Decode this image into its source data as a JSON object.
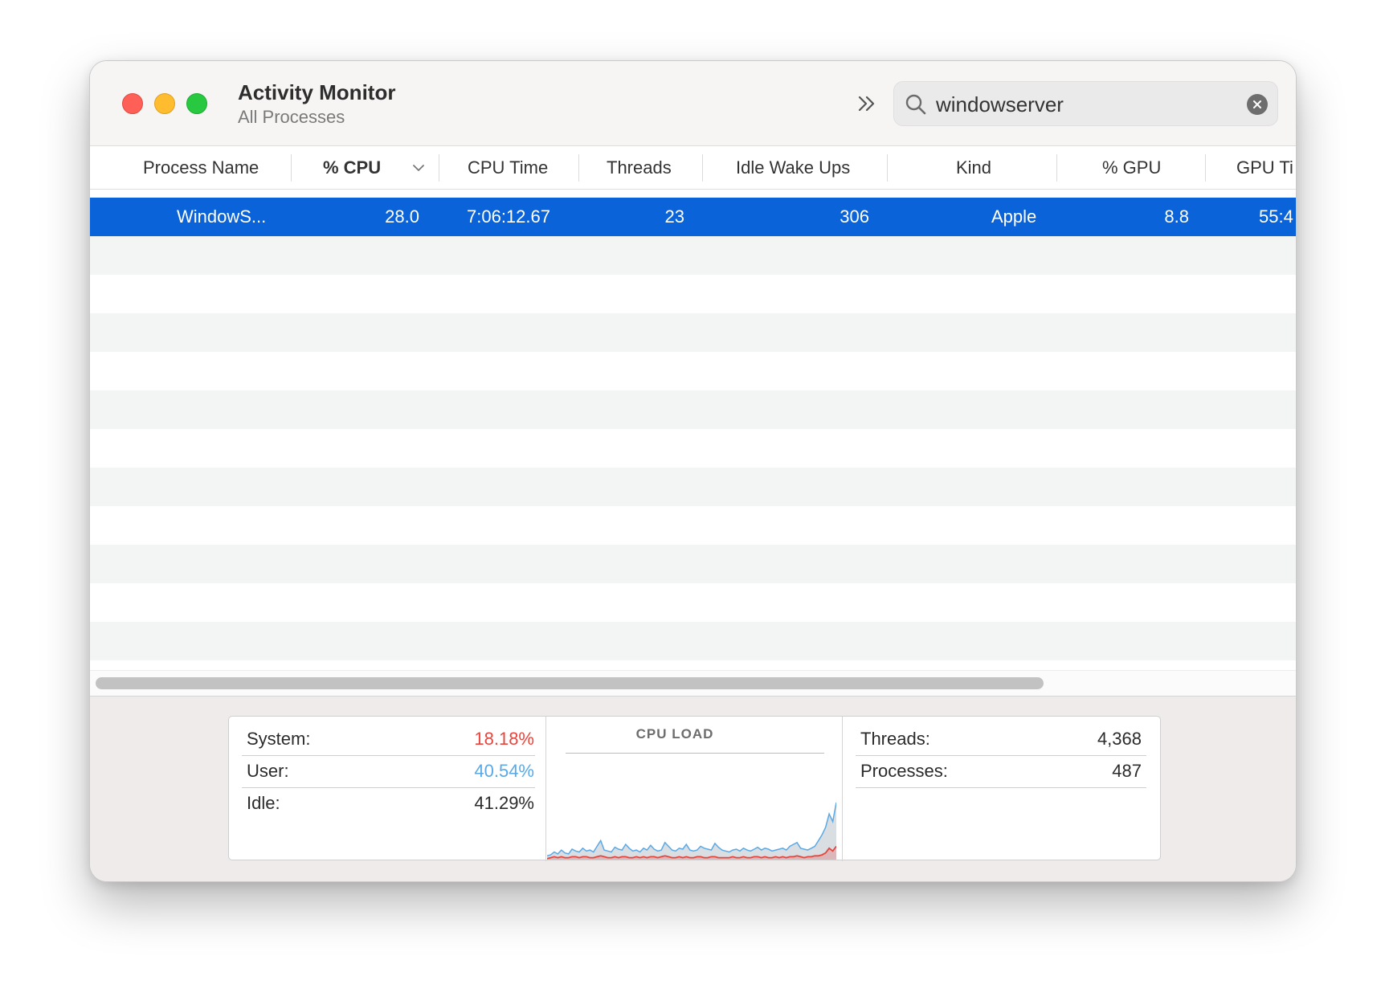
{
  "app": {
    "title": "Activity Monitor",
    "subtitle": "All Processes"
  },
  "toolbar": {
    "overflow_icon": "chevrons-right-icon"
  },
  "search": {
    "value": "windowserver",
    "icon": "search-icon",
    "clear_icon": "clear-icon"
  },
  "columns": [
    "Process Name",
    "% CPU",
    "CPU Time",
    "Threads",
    "Idle Wake Ups",
    "Kind",
    "% GPU",
    "GPU Ti"
  ],
  "sort": {
    "column": "% CPU",
    "direction": "descending"
  },
  "processes": [
    {
      "name": "WindowS...",
      "cpu": "28.0",
      "cpu_time": "7:06:12.67",
      "threads": "23",
      "idle_wake_ups": "306",
      "kind": "Apple",
      "gpu": "8.8",
      "gpu_time": "55:4",
      "selected": true
    }
  ],
  "cpu_stats": {
    "system_label": "System:",
    "system_value": "18.18%",
    "user_label": "User:",
    "user_value": "40.54%",
    "idle_label": "Idle:",
    "idle_value": "41.29%"
  },
  "cpu_load": {
    "title": "CPU LOAD",
    "colors": {
      "system": "#e8453c",
      "user": "#5aa9e6",
      "fill": "#d9dee3"
    },
    "user_series": [
      4,
      5,
      8,
      6,
      10,
      7,
      6,
      11,
      9,
      8,
      12,
      9,
      10,
      8,
      14,
      20,
      10,
      9,
      8,
      13,
      11,
      10,
      16,
      12,
      9,
      10,
      8,
      12,
      10,
      15,
      11,
      9,
      10,
      18,
      14,
      10,
      9,
      12,
      11,
      16,
      10,
      9,
      10,
      14,
      12,
      11,
      10,
      17,
      13,
      10,
      9,
      8,
      10,
      11,
      9,
      12,
      10,
      9,
      11,
      13,
      10,
      12,
      11,
      9,
      10,
      11,
      12,
      10,
      14,
      16,
      18,
      12,
      11,
      10,
      12,
      14,
      20,
      26,
      34,
      48,
      40,
      60
    ],
    "system_series": [
      1,
      2,
      3,
      2,
      3,
      2,
      2,
      3,
      3,
      2,
      3,
      3,
      2,
      2,
      3,
      4,
      3,
      2,
      2,
      3,
      2,
      3,
      3,
      2,
      2,
      3,
      2,
      3,
      2,
      3,
      3,
      2,
      3,
      4,
      3,
      2,
      2,
      3,
      2,
      3,
      2,
      2,
      3,
      3,
      2,
      2,
      3,
      3,
      2,
      2,
      2,
      2,
      3,
      2,
      2,
      3,
      2,
      2,
      3,
      3,
      2,
      3,
      2,
      2,
      3,
      2,
      3,
      2,
      3,
      3,
      4,
      3,
      2,
      3,
      3,
      4,
      4,
      5,
      7,
      12,
      9,
      14
    ]
  },
  "thread_stats": {
    "threads_label": "Threads:",
    "threads_value": "4,368",
    "processes_label": "Processes:",
    "processes_value": "487"
  },
  "colors": {
    "selection": "#0a63d8",
    "system_value": "#e8453c",
    "user_value": "#5aa9e6"
  }
}
